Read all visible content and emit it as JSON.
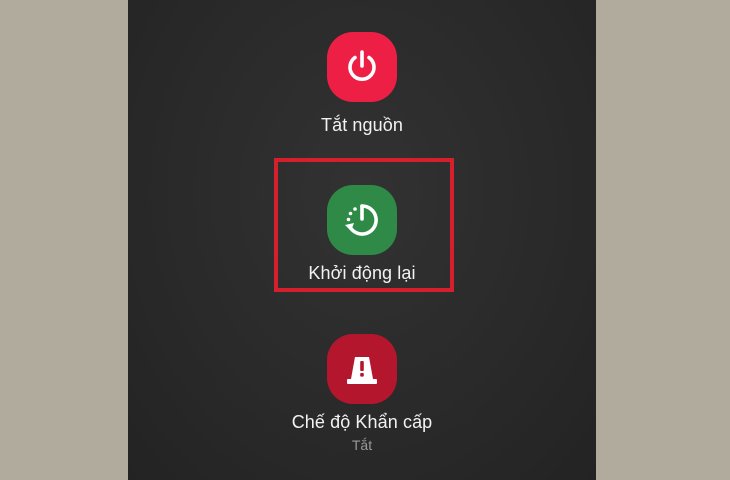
{
  "power_menu": {
    "items": [
      {
        "label": "Tắt nguồn",
        "icon": "power-icon",
        "color": "#ee1f45"
      },
      {
        "label": "Khởi động lại",
        "icon": "restart-icon",
        "color": "#2f8a47"
      },
      {
        "label": "Chế độ Khẩn cấp",
        "sublabel": "Tắt",
        "icon": "emergency-icon",
        "color": "#b4162e"
      }
    ]
  },
  "highlight": {
    "target": "restart",
    "color": "#d4202d"
  }
}
